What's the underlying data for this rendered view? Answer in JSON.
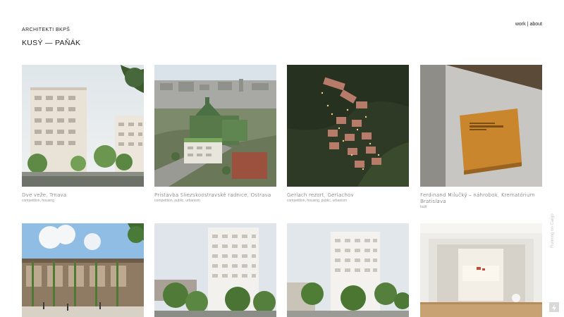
{
  "header": {
    "brand": "ARCHITEKTI BKPŠ",
    "studio": "KUSÝ — PAŇÁK"
  },
  "nav": {
    "work": "work",
    "separator": "|",
    "about": "about"
  },
  "projects": [
    {
      "title": "Dve veže, Trnava",
      "tags": "competition, housing"
    },
    {
      "title": "Prístavba Sliezskoostravské radnice, Ostrava",
      "tags": "competition, public, urbanism"
    },
    {
      "title": "Gerlach rezort, Gerlachov",
      "tags": "competition, housing, public, urbanism"
    },
    {
      "title": "Ferdinand Milučký – náhrobok, Krematórium Bratislava",
      "tags": "built"
    },
    {
      "title": "",
      "tags": ""
    },
    {
      "title": "",
      "tags": ""
    },
    {
      "title": "",
      "tags": ""
    },
    {
      "title": "",
      "tags": ""
    }
  ],
  "footer": {
    "running_on": "Running on Cargo"
  }
}
